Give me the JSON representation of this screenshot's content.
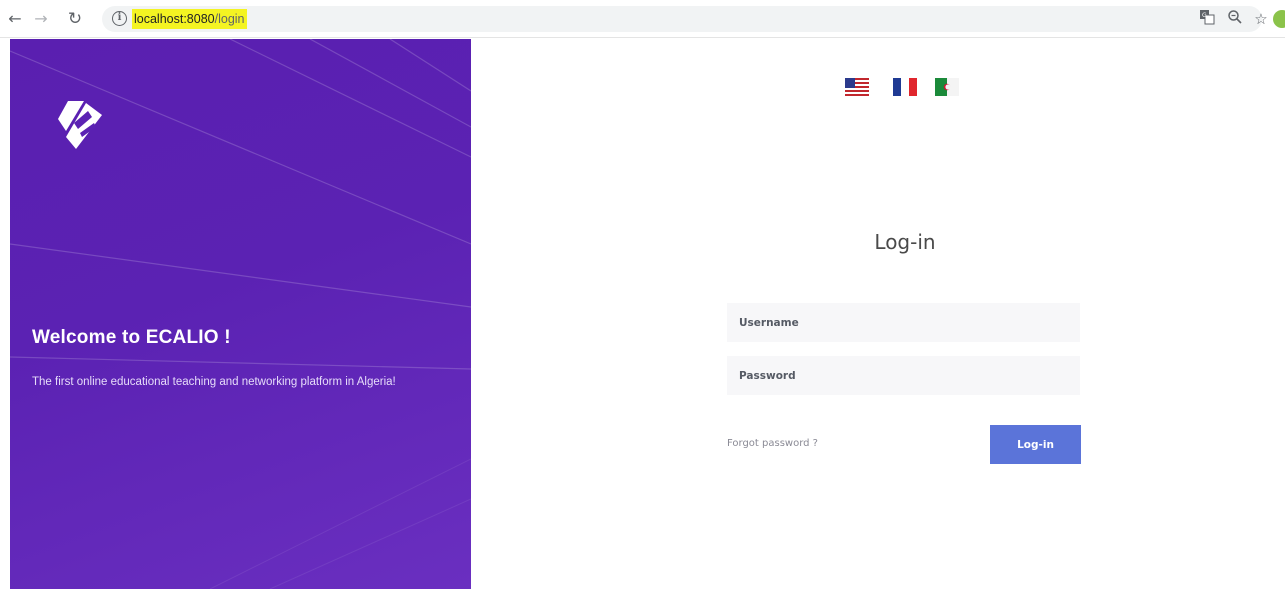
{
  "browser": {
    "url_host": "localhost:8080",
    "url_path": "/login",
    "back_icon": "arrow-left-icon",
    "forward_icon": "arrow-right-icon",
    "reload_icon": "reload-icon",
    "info_icon": "info-icon",
    "translate_icon": "translate-icon",
    "zoom_icon": "zoom-icon",
    "bookmark_icon": "star-icon"
  },
  "hero": {
    "title": "Welcome to ECALIO !",
    "subtitle": "The first online educational teaching and networking platform in Algeria!",
    "background_color": "#5b22b3"
  },
  "languages": [
    {
      "code": "en",
      "flag": "us-flag-icon"
    },
    {
      "code": "fr",
      "flag": "france-flag-icon"
    },
    {
      "code": "ar",
      "flag": "algeria-flag-icon"
    }
  ],
  "login": {
    "title": "Log-in",
    "username_placeholder": "Username",
    "password_placeholder": "Password",
    "forgot_label": "Forgot password ?",
    "submit_label": "Log-in",
    "button_color": "#5b74d9"
  }
}
